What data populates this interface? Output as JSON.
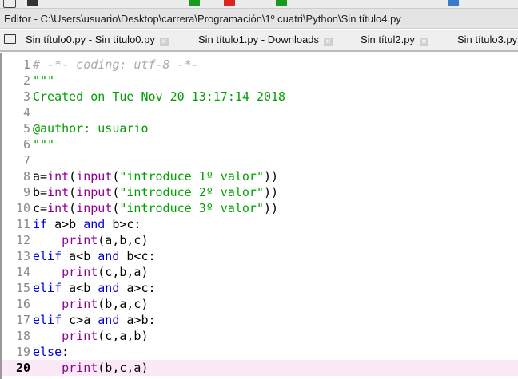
{
  "title": "Editor - C:\\Users\\usuario\\Desktop\\carrera\\Programación\\1º cuatri\\Python\\Sin título4.py",
  "tabs": [
    {
      "label": "Sin título0.py - Sin título0.py"
    },
    {
      "label": "Sin título1.py - Downloads"
    },
    {
      "label": "Sin títul2.py"
    },
    {
      "label": "Sin título3.py"
    }
  ],
  "colors": {
    "keyword": "#0000e0",
    "builtin": "#900090",
    "string": "#00a000",
    "comment": "#aaaaaa",
    "current_line": "#fbe9f8"
  },
  "current_line": 20,
  "lines": [
    [
      [
        "# -*- coding: utf-8 -*-",
        "comment"
      ]
    ],
    [
      [
        "\"\"\"",
        "string"
      ]
    ],
    [
      [
        "Created on Tue Nov 20 13:17:14 2018",
        "string"
      ]
    ],
    [],
    [
      [
        "@author: usuario",
        "string"
      ]
    ],
    [
      [
        "\"\"\"",
        "string"
      ]
    ],
    [],
    [
      [
        "a=",
        "plain"
      ],
      [
        "int",
        "builtin"
      ],
      [
        "(",
        "plain"
      ],
      [
        "input",
        "builtin"
      ],
      [
        "(",
        "plain"
      ],
      [
        "\"introduce 1º valor\"",
        "string"
      ],
      [
        "))",
        "plain"
      ]
    ],
    [
      [
        "b=",
        "plain"
      ],
      [
        "int",
        "builtin"
      ],
      [
        "(",
        "plain"
      ],
      [
        "input",
        "builtin"
      ],
      [
        "(",
        "plain"
      ],
      [
        "\"introduce 2º valor\"",
        "string"
      ],
      [
        "))",
        "plain"
      ]
    ],
    [
      [
        "c=",
        "plain"
      ],
      [
        "int",
        "builtin"
      ],
      [
        "(",
        "plain"
      ],
      [
        "input",
        "builtin"
      ],
      [
        "(",
        "plain"
      ],
      [
        "\"introduce 3º valor\"",
        "string"
      ],
      [
        "))",
        "plain"
      ]
    ],
    [
      [
        "if",
        "kw"
      ],
      [
        " a>b ",
        "plain"
      ],
      [
        "and",
        "kw"
      ],
      [
        " b>c:",
        "plain"
      ]
    ],
    [
      [
        "    ",
        "plain"
      ],
      [
        "print",
        "builtin"
      ],
      [
        "(a,b,c)",
        "plain"
      ]
    ],
    [
      [
        "elif",
        "kw"
      ],
      [
        " a<b ",
        "plain"
      ],
      [
        "and",
        "kw"
      ],
      [
        " b<c:",
        "plain"
      ]
    ],
    [
      [
        "    ",
        "plain"
      ],
      [
        "print",
        "builtin"
      ],
      [
        "(c,b,a)",
        "plain"
      ]
    ],
    [
      [
        "elif",
        "kw"
      ],
      [
        " a<b ",
        "plain"
      ],
      [
        "and",
        "kw"
      ],
      [
        " a>c:",
        "plain"
      ]
    ],
    [
      [
        "    ",
        "plain"
      ],
      [
        "print",
        "builtin"
      ],
      [
        "(b,a,c)",
        "plain"
      ]
    ],
    [
      [
        "elif",
        "kw"
      ],
      [
        " c>a ",
        "plain"
      ],
      [
        "and",
        "kw"
      ],
      [
        " a>b:",
        "plain"
      ]
    ],
    [
      [
        "    ",
        "plain"
      ],
      [
        "print",
        "builtin"
      ],
      [
        "(c,a,b)",
        "plain"
      ]
    ],
    [
      [
        "else",
        "kw"
      ],
      [
        ":",
        "plain"
      ]
    ],
    [
      [
        "    ",
        "plain"
      ],
      [
        "print",
        "builtin"
      ],
      [
        "(b,c,a)",
        "plain"
      ]
    ]
  ]
}
